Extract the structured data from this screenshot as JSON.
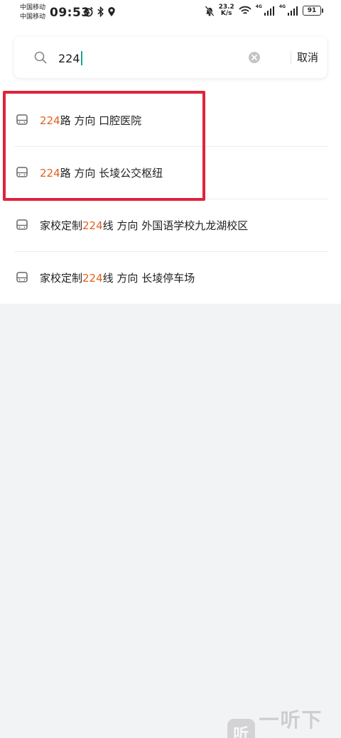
{
  "status_bar": {
    "carrier_1": "中国移动",
    "carrier_2": "中国移动",
    "time": "09:53",
    "speed_value": "23.2",
    "speed_unit": "K/s",
    "net_1": "4G",
    "net_2": "4G",
    "battery": "91"
  },
  "search": {
    "query": "224",
    "cancel_label": "取消"
  },
  "results": [
    {
      "prefix": "",
      "highlight": "224",
      "suffix": "路 方向 口腔医院"
    },
    {
      "prefix": "",
      "highlight": "224",
      "suffix": "路 方向 长堎公交枢纽"
    },
    {
      "prefix": "家校定制",
      "highlight": "224",
      "suffix": "线 方向 外国语学校九龙湖校区"
    },
    {
      "prefix": "家校定制",
      "highlight": "224",
      "suffix": "线 方向 长堎停车场"
    }
  ],
  "colors": {
    "highlight": "#e2601f",
    "annotation_box": "#e0233a",
    "caret": "#1aa394"
  },
  "watermark": {
    "logo_char": "听",
    "text": "一听下载"
  }
}
